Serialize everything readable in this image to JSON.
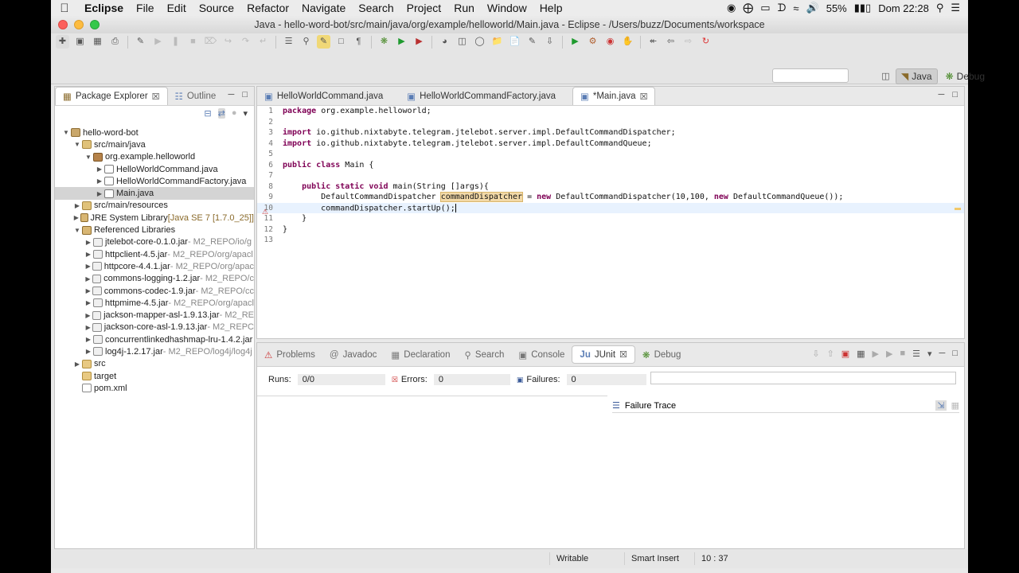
{
  "menubar": {
    "app": "Eclipse",
    "menus": [
      "File",
      "Edit",
      "Source",
      "Refactor",
      "Navigate",
      "Search",
      "Project",
      "Run",
      "Window",
      "Help"
    ],
    "battery": "55%",
    "clock": "Dom 22:28"
  },
  "window": {
    "title": "Java - hello-word-bot/src/main/java/org/example/helloworld/Main.java - Eclipse - /Users/buzz/Documents/workspace"
  },
  "perspectives": {
    "java": "Java",
    "debug": "Debug"
  },
  "package_explorer": {
    "tabs": [
      "Package Explorer",
      "Outline"
    ],
    "tree": [
      {
        "label": "hello-word-bot",
        "extra": "",
        "icon": "project",
        "level": 0,
        "twisty": "open"
      },
      {
        "label": "src/main/java",
        "extra": "",
        "icon": "srcfolder",
        "level": 1,
        "twisty": "open"
      },
      {
        "label": "org.example.helloworld",
        "extra": "",
        "icon": "package",
        "level": 2,
        "twisty": "open"
      },
      {
        "label": "HelloWorldCommand.java",
        "extra": "",
        "icon": "java",
        "level": 3,
        "twisty": "closed"
      },
      {
        "label": "HelloWorldCommandFactory.java",
        "extra": "",
        "icon": "java",
        "level": 3,
        "twisty": "closed"
      },
      {
        "label": "Main.java",
        "extra": "",
        "icon": "java",
        "level": 3,
        "twisty": "closed",
        "selected": true
      },
      {
        "label": "src/main/resources",
        "extra": "",
        "icon": "srcfolder",
        "level": 1,
        "twisty": "closed"
      },
      {
        "label": "JRE System Library",
        "extra": " [Java SE 7 [1.7.0_25]]",
        "icon": "lib",
        "level": 1,
        "twisty": "closed"
      },
      {
        "label": "Referenced Libraries",
        "extra": "",
        "icon": "lib",
        "level": 1,
        "twisty": "open"
      },
      {
        "label": "jtelebot-core-0.1.0.jar",
        "extra": " - M2_REPO/io/g",
        "icon": "jar",
        "level": 2,
        "twisty": "closed"
      },
      {
        "label": "httpclient-4.5.jar",
        "extra": " - M2_REPO/org/apacl",
        "icon": "jar",
        "level": 2,
        "twisty": "closed"
      },
      {
        "label": "httpcore-4.4.1.jar",
        "extra": " - M2_REPO/org/apac",
        "icon": "jar",
        "level": 2,
        "twisty": "closed"
      },
      {
        "label": "commons-logging-1.2.jar",
        "extra": " - M2_REPO/c",
        "icon": "jar",
        "level": 2,
        "twisty": "closed"
      },
      {
        "label": "commons-codec-1.9.jar",
        "extra": " - M2_REPO/cc",
        "icon": "jar",
        "level": 2,
        "twisty": "closed"
      },
      {
        "label": "httpmime-4.5.jar",
        "extra": " - M2_REPO/org/apacl",
        "icon": "jar",
        "level": 2,
        "twisty": "closed"
      },
      {
        "label": "jackson-mapper-asl-1.9.13.jar",
        "extra": " - M2_RE",
        "icon": "jar",
        "level": 2,
        "twisty": "closed"
      },
      {
        "label": "jackson-core-asl-1.9.13.jar",
        "extra": " - M2_REPC",
        "icon": "jar",
        "level": 2,
        "twisty": "closed"
      },
      {
        "label": "concurrentlinkedhashmap-lru-1.4.2.jar",
        "extra": "",
        "icon": "jar",
        "level": 2,
        "twisty": "closed"
      },
      {
        "label": "log4j-1.2.17.jar",
        "extra": " - M2_REPO/log4j/log4j",
        "icon": "jar",
        "level": 2,
        "twisty": "closed"
      },
      {
        "label": "src",
        "extra": "",
        "icon": "folder",
        "level": 1,
        "twisty": "closed"
      },
      {
        "label": "target",
        "extra": "",
        "icon": "folder",
        "level": 1,
        "twisty": "none"
      },
      {
        "label": "pom.xml",
        "extra": "",
        "icon": "xml",
        "level": 1,
        "twisty": "none"
      }
    ]
  },
  "editor": {
    "tabs": [
      "HelloWorldCommand.java",
      "HelloWorldCommandFactory.java",
      "*Main.java"
    ],
    "active_tab": 2,
    "lines": [
      {
        "n": "1",
        "segs": [
          [
            "kw",
            "package"
          ],
          [
            "",
            "org.example.helloworld;"
          ]
        ]
      },
      {
        "n": "2",
        "segs": []
      },
      {
        "n": "3",
        "segs": [
          [
            "kw",
            "import"
          ],
          [
            "",
            "io.github.nixtabyte.telegram.jtelebot.server.impl.DefaultCommandDispatcher;"
          ]
        ]
      },
      {
        "n": "4",
        "segs": [
          [
            "kw",
            "import"
          ],
          [
            "",
            "io.github.nixtabyte.telegram.jtelebot.server.impl.DefaultCommandQueue;"
          ]
        ]
      },
      {
        "n": "5",
        "segs": []
      },
      {
        "n": "6",
        "segs": [
          [
            "kw",
            "public"
          ],
          [
            "kw",
            "class"
          ],
          [
            "",
            "Main {"
          ]
        ]
      },
      {
        "n": "7",
        "segs": []
      },
      {
        "n": "8",
        "segs": [
          [
            "",
            "    "
          ],
          [
            "kw",
            "public"
          ],
          [
            "kw",
            "static"
          ],
          [
            "kw",
            "void"
          ],
          [
            "",
            "main(String []args){"
          ]
        ]
      },
      {
        "n": "9",
        "segs": [
          [
            "",
            "        DefaultCommandDispatcher "
          ],
          [
            "hl",
            "commandDispatcher"
          ],
          [
            "",
            " = "
          ],
          [
            "kw",
            "new"
          ],
          [
            "",
            "DefaultCommandDispatcher(10,100, "
          ],
          [
            "kw",
            "new"
          ],
          [
            "",
            "DefaultCommandQueue());"
          ]
        ]
      },
      {
        "n": "10",
        "segs": [
          [
            "",
            "        commandDispatcher.startUp();"
          ],
          [
            "cursor",
            ""
          ]
        ],
        "current": true
      },
      {
        "n": "11",
        "segs": [
          [
            "",
            "    }"
          ]
        ]
      },
      {
        "n": "12",
        "segs": [
          [
            "",
            "}"
          ]
        ]
      },
      {
        "n": "13",
        "segs": []
      }
    ]
  },
  "bottom_panel": {
    "tabs": [
      "Problems",
      "Javadoc",
      "Declaration",
      "Search",
      "Console",
      "JUnit",
      "Debug"
    ],
    "active_tab": 5,
    "runs_label": "Runs:",
    "runs_value": "0/0",
    "errors_label": "Errors:",
    "errors_value": "0",
    "failures_label": "Failures:",
    "failures_value": "0",
    "failure_trace": "Failure Trace"
  },
  "statusbar": {
    "writable": "Writable",
    "insert_mode": "Smart Insert",
    "position": "10 : 37"
  }
}
